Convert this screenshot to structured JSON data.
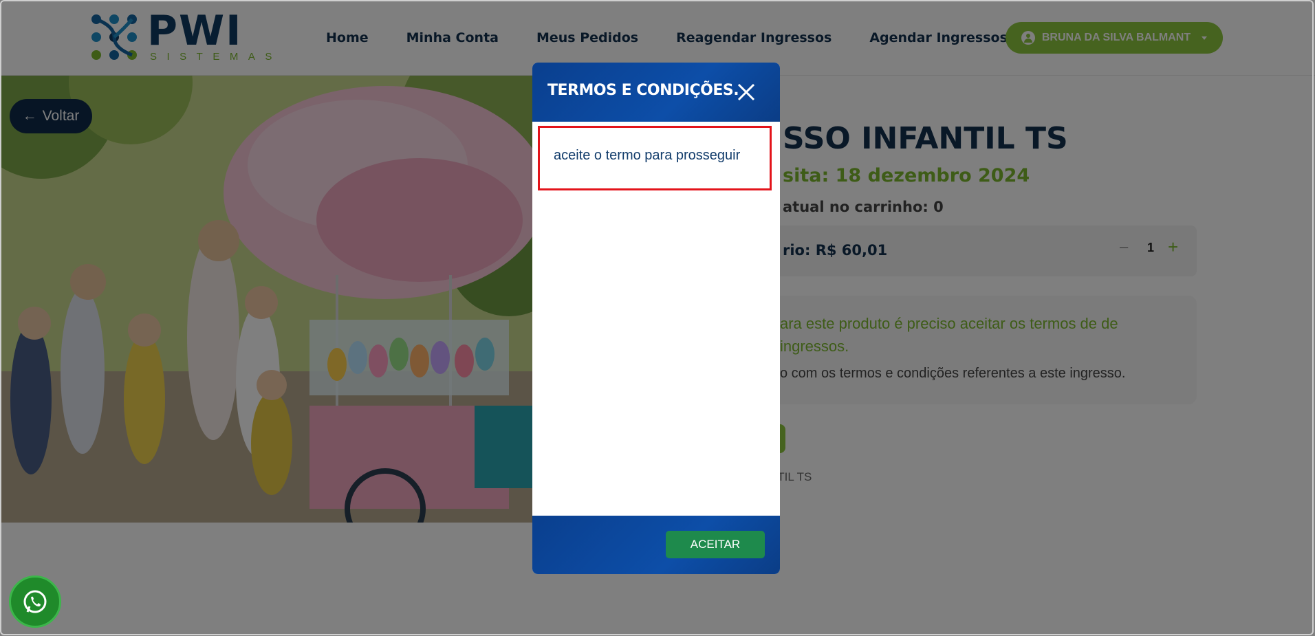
{
  "brand": {
    "name": "PWI",
    "tagline": "SISTEMAS"
  },
  "nav": {
    "items": [
      {
        "label": "Home"
      },
      {
        "label": "Minha Conta"
      },
      {
        "label": "Meus Pedidos"
      },
      {
        "label": "Reagendar Ingressos"
      },
      {
        "label": "Agendar Ingressos"
      }
    ],
    "user_label": "BRUNA DA SILVA BALMANT"
  },
  "hero": {
    "back_label": "Voltar"
  },
  "product": {
    "title": "SSO INFANTIL TS",
    "visit_date": "sita: 18 dezembro 2024",
    "cart_quantity": "atual no carrinho: 0",
    "price_label": "rio: R$ 60,01",
    "quantity": "1",
    "terms_warning": "ara este produto é preciso aceitar os termos de de ingressos.",
    "terms_note": "o com os termos e condições referentes a este ingresso.",
    "reference_text": "NTIL TS"
  },
  "modal": {
    "title": "TERMOS E CONDIÇÕES.",
    "term_text": "aceite o termo para prosseguir",
    "accept_label": "ACEITAR"
  },
  "colors": {
    "brand_green": "#8dc63f",
    "brand_navy": "#12304f",
    "modal_blue": "#0d4ea8",
    "accept_green": "#1e8a4c",
    "highlight_red": "#e3141b"
  }
}
